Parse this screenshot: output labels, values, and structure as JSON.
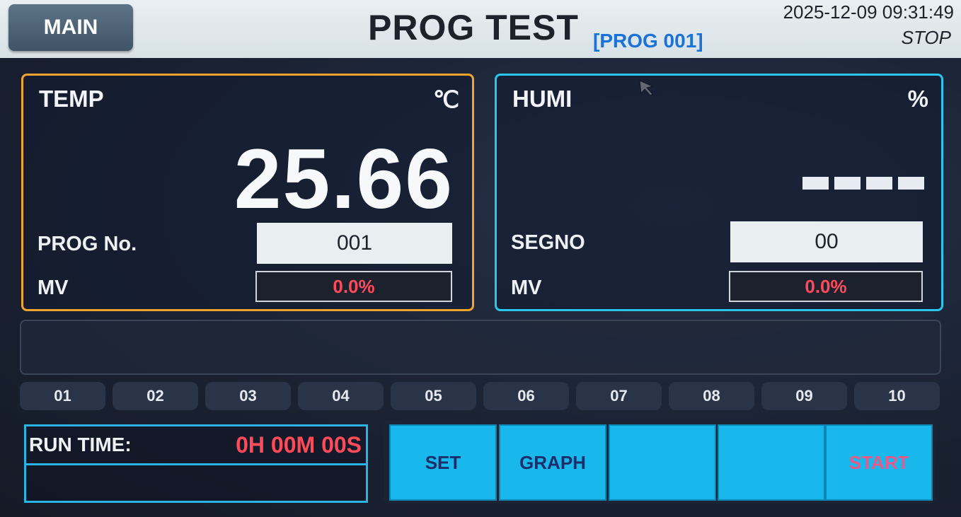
{
  "header": {
    "main_label": "MAIN",
    "title": "PROG TEST",
    "subtitle": "[PROG 001]",
    "datetime": "2025-12-09 09:31:49",
    "state": "STOP"
  },
  "temp_panel": {
    "label": "TEMP",
    "unit": "℃",
    "value": "25.66",
    "prog_label": "PROG No.",
    "prog_value": "001",
    "mv_label": "MV",
    "mv_value": "0.0%"
  },
  "humi_panel": {
    "label": "HUMI",
    "unit": "%",
    "segno_label": "SEGNO",
    "segno_value": "00",
    "mv_label": "MV",
    "mv_value": "0.0%"
  },
  "steps": [
    "01",
    "02",
    "03",
    "04",
    "05",
    "06",
    "07",
    "08",
    "09",
    "10"
  ],
  "run_time": {
    "label": "RUN TIME:",
    "value": "0H 00M 00S"
  },
  "buttons": {
    "set": "SET",
    "graph": "GRAPH",
    "blank1": "",
    "blank2": "",
    "start": "START"
  },
  "colors": {
    "temp_border": "#f0a42c",
    "humi_border": "#2ac6ee",
    "mv_value": "#ff4a5a",
    "button_bg": "#19b8ec",
    "subtitle": "#1a72d6"
  }
}
